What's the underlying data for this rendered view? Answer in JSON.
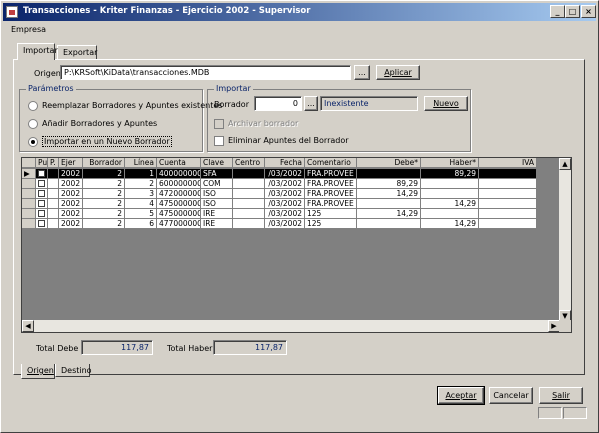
{
  "window": {
    "title": "Transacciones - Kriter Finanzas - Ejercicio 2002 - Supervisor",
    "min_symbol": "_",
    "max_symbol": "□",
    "close_symbol": "×"
  },
  "menu": {
    "empresa": "Empresa"
  },
  "tabs": {
    "importar": "Importar",
    "exportar": "Exportar"
  },
  "origen": {
    "label": "Origen",
    "path": "P:\\KRSoft\\KiData\\transacciones.MDB",
    "browse": "...",
    "aplicar": "Aplicar"
  },
  "parametros": {
    "title": "Parámetros",
    "opt1": "Reemplazar Borradores y Apuntes existentes",
    "opt2": "Añadir Borradores y Apuntes",
    "opt3": "Importar en un Nuevo Borrador",
    "selected": "opt3"
  },
  "importar_group": {
    "title": "Importar",
    "borrador_label": "Borrador",
    "borrador_value": "0",
    "browse": "...",
    "status": "Inexistente",
    "nuevo": "Nuevo",
    "archivar": "Archivar borrador",
    "eliminar": "Eliminar Apuntes del Borrador"
  },
  "grid": {
    "headers": [
      "Pu",
      "P.",
      "Ejer",
      "Borrador",
      "Línea",
      "Cuenta",
      "Clave",
      "Centro",
      "Fecha",
      "Comentario",
      "Debe*",
      "Haber*",
      "IVA"
    ],
    "rows": [
      {
        "ejer": "2002",
        "borrador": "2",
        "linea": "1",
        "cuenta": "400000000",
        "clave": "SFA",
        "centro": "",
        "fecha": "/03/2002",
        "comentario": "FRA.PROVEE",
        "debe": "",
        "haber": "89,29",
        "iva": ""
      },
      {
        "ejer": "2002",
        "borrador": "2",
        "linea": "2",
        "cuenta": "600000000",
        "clave": "COM",
        "centro": "",
        "fecha": "/03/2002",
        "comentario": "FRA.PROVEE",
        "debe": "89,29",
        "haber": "",
        "iva": ""
      },
      {
        "ejer": "2002",
        "borrador": "2",
        "linea": "3",
        "cuenta": "472000000",
        "clave": "ISO",
        "centro": "",
        "fecha": "/03/2002",
        "comentario": "FRA.PROVEE",
        "debe": "14,29",
        "haber": "",
        "iva": ""
      },
      {
        "ejer": "2002",
        "borrador": "2",
        "linea": "4",
        "cuenta": "475000000",
        "clave": "ISO",
        "centro": "",
        "fecha": "/03/2002",
        "comentario": "FRA.PROVEE",
        "debe": "",
        "haber": "14,29",
        "iva": ""
      },
      {
        "ejer": "2002",
        "borrador": "2",
        "linea": "5",
        "cuenta": "475000000",
        "clave": "IRE",
        "centro": "",
        "fecha": "/03/2002",
        "comentario": "125",
        "debe": "14,29",
        "haber": "",
        "iva": ""
      },
      {
        "ejer": "2002",
        "borrador": "2",
        "linea": "6",
        "cuenta": "477000000",
        "clave": "IRE",
        "centro": "",
        "fecha": "/03/2002",
        "comentario": "125",
        "debe": "",
        "haber": "14,29",
        "iva": ""
      }
    ],
    "selected_row": 0
  },
  "totals": {
    "debe_label": "Total Debe",
    "debe_value": "117,87",
    "haber_label": "Total Haber",
    "haber_value": "117,87"
  },
  "bottom_tabs": {
    "origen": "Origen",
    "destino": "Destino"
  },
  "buttons": {
    "aceptar": "Aceptar",
    "cancelar": "Cancelar",
    "salir": "Salir"
  }
}
